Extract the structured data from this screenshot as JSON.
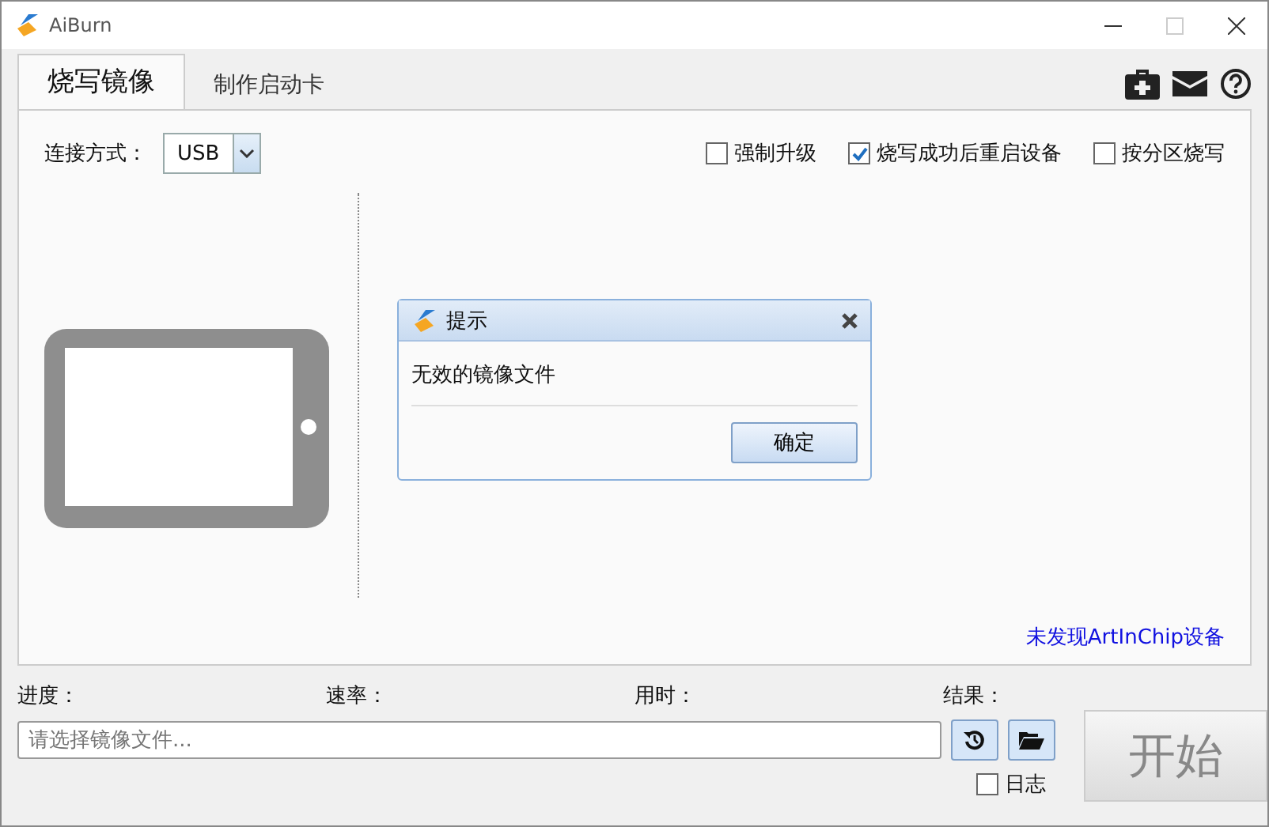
{
  "window": {
    "title": "AiBurn"
  },
  "tabs": [
    {
      "label": "烧写镜像",
      "selected": true
    },
    {
      "label": "制作启动卡",
      "selected": false
    }
  ],
  "connection": {
    "label": "连接方式：",
    "value": "USB"
  },
  "options": [
    {
      "label": "强制升级",
      "checked": false
    },
    {
      "label": "烧写成功后重启设备",
      "checked": true
    },
    {
      "label": "按分区烧写",
      "checked": false
    }
  ],
  "device_status": "未发现ArtInChip设备",
  "dialog": {
    "title": "提示",
    "message": "无效的镜像文件",
    "button": "确定"
  },
  "stats": [
    "进度：",
    "速率：",
    "用时：",
    "结果："
  ],
  "file_field": {
    "placeholder": "请选择镜像文件..."
  },
  "start_button": {
    "label": "开始",
    "disabled": true
  },
  "log": {
    "label": "日志",
    "checked": false
  }
}
